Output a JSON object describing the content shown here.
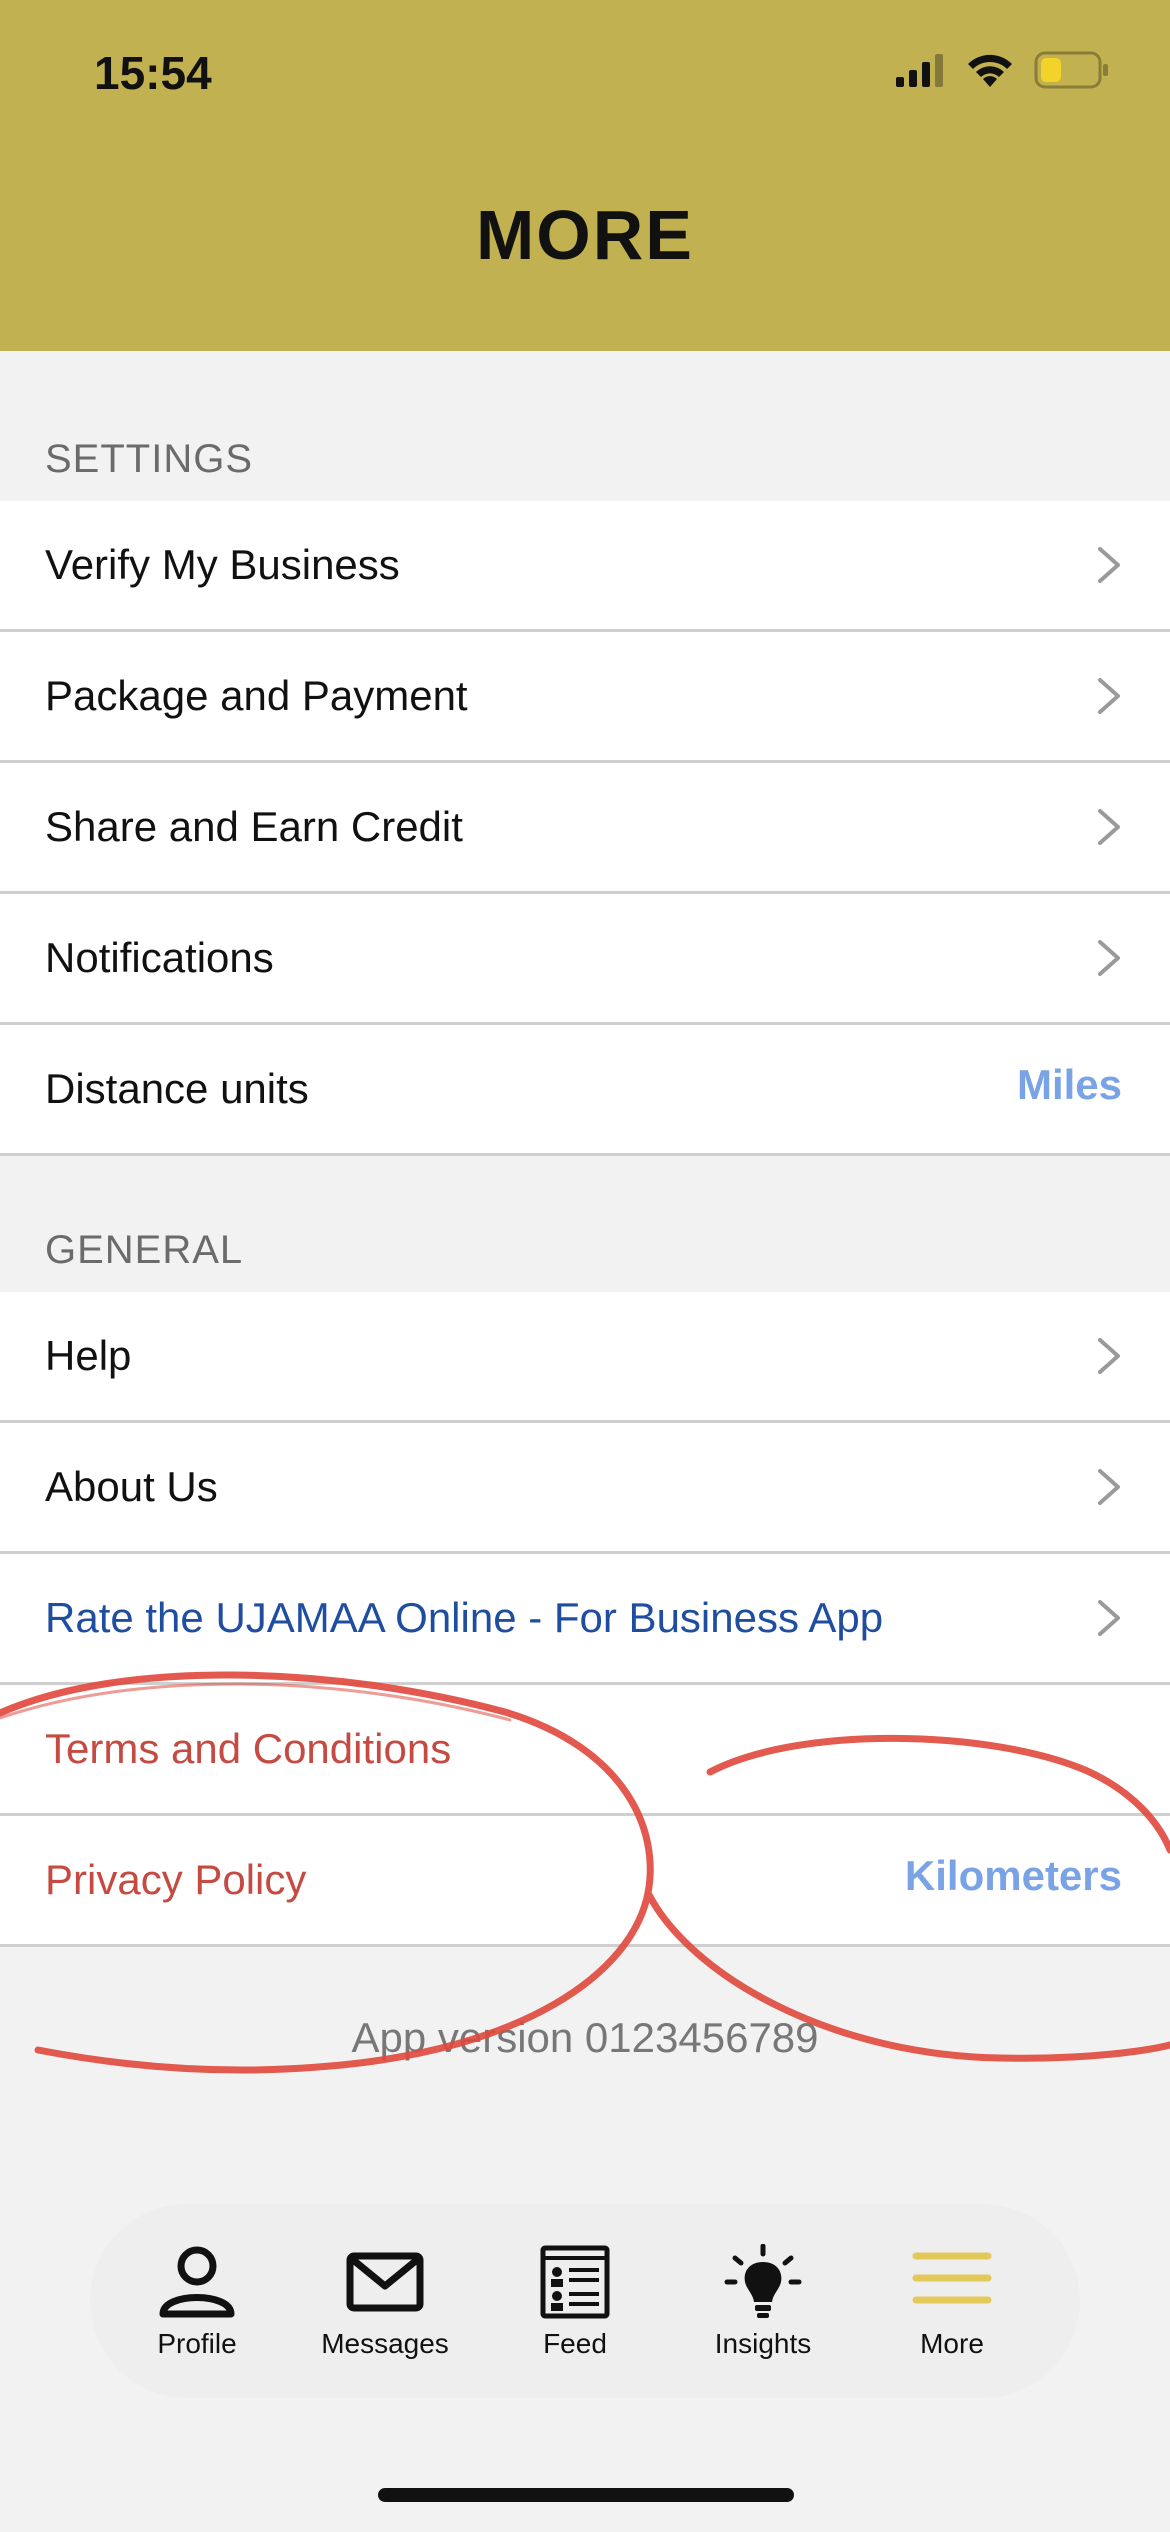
{
  "status_bar": {
    "time": "15:54"
  },
  "header": {
    "title": "MORE"
  },
  "settings": {
    "header": "SETTINGS",
    "items": [
      {
        "label": "Verify My Business"
      },
      {
        "label": "Package and Payment"
      },
      {
        "label": "Share and Earn Credit"
      },
      {
        "label": "Notifications"
      },
      {
        "label": "Distance units",
        "value": "Miles"
      }
    ]
  },
  "general": {
    "header": "GENERAL",
    "items": [
      {
        "label": "Help"
      },
      {
        "label": "About Us"
      },
      {
        "label": "Rate the UJAMAA Online - For Business App"
      },
      {
        "label": "Terms and Conditions"
      },
      {
        "label": "Privacy Policy",
        "value": "Kilometers"
      }
    ]
  },
  "footer": {
    "app_version": "App version 0123456789"
  },
  "tabbar": {
    "items": [
      {
        "label": "Profile",
        "icon": "person-icon"
      },
      {
        "label": "Messages",
        "icon": "envelope-icon"
      },
      {
        "label": "Feed",
        "icon": "feed-icon"
      },
      {
        "label": "Insights",
        "icon": "lightbulb-icon"
      },
      {
        "label": "More",
        "icon": "menu-icon",
        "active": true
      }
    ]
  },
  "colors": {
    "header_bg": "#c2b150",
    "accent_blue": "#7aa3e6",
    "link_blue": "#1f4ea0",
    "red": "#c54a42",
    "active_tab": "#e3c95a"
  }
}
